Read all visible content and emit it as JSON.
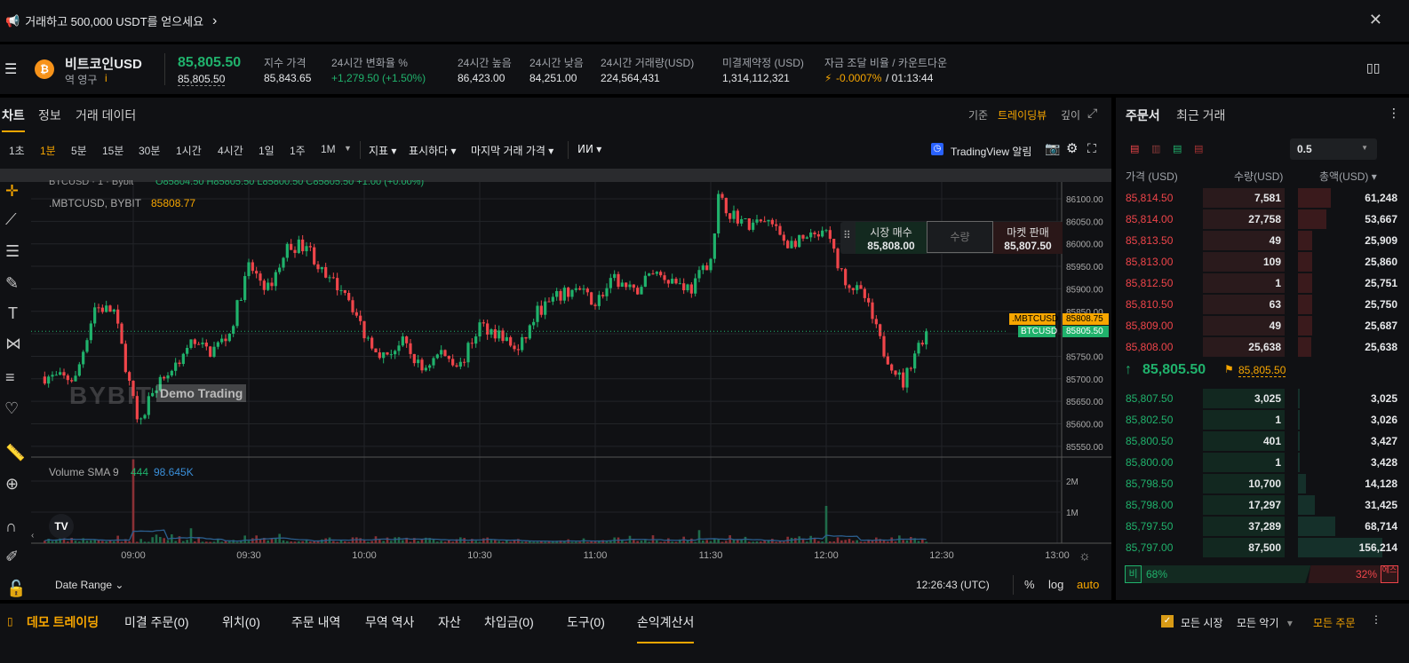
{
  "banner": {
    "text": "거래하고 500,000 USDT를 얻으세요",
    "chevron": "›",
    "close": "✕"
  },
  "ticker": {
    "name": "비트코인USD",
    "sub": "역 영구",
    "info": "i",
    "price": "85,805.50",
    "mark": "85,805.50",
    "stats": [
      {
        "label": "지수 가격",
        "value": "85,843.65"
      },
      {
        "label": "24시간 변화율 %",
        "value": "+1,279.50 (+1.50%)"
      },
      {
        "label": "24시간 높음",
        "value": "86,423.00"
      },
      {
        "label": "24시간 낮음",
        "value": "84,251.00"
      },
      {
        "label": "24시간 거래량(USD)",
        "value": "224,564,431"
      },
      {
        "label": "미결제약정 (USD)",
        "value": "1,314,112,321"
      },
      {
        "label": "자금 조달 비율 / 카운트다운",
        "value": "-0.0007%",
        "countdown": "/ 01:13:44"
      }
    ]
  },
  "chart_tabs": [
    "차트",
    "정보",
    "거래 데이터"
  ],
  "view_modes": {
    "basic": "기준",
    "tradingview": "트레이딩뷰",
    "depth": "깊이"
  },
  "intervals": [
    "1초",
    "1분",
    "5분",
    "15분",
    "30분",
    "1시간",
    "4시간",
    "1일",
    "1주",
    "1M"
  ],
  "active_interval": "1분",
  "toolbar": {
    "indicators": "지표",
    "display": "표시하다",
    "last_price": "마지막 거래 가격",
    "alert": "TradingView 알림"
  },
  "legend": {
    "symbol": "BTCUSD · 1 · Bybit",
    "ohlc": "O85804.50 H85805.50 L85800.50 C85805.50 +1.00 (+0.00%)",
    "index_symbol": ".MBTCUSD, BYBIT",
    "index_value": "85808.77",
    "volume_label": "Volume SMA 9",
    "volume_value": "444",
    "sma_value": "98.645K"
  },
  "watermark": {
    "logo": "BYBIT",
    "text": "Demo Trading"
  },
  "quick_trade": {
    "buy_label": "시장 매수",
    "buy_price": "85,808.00",
    "qty_placeholder": "수량",
    "sell_label": "마켓 판매",
    "sell_price": "85,807.50"
  },
  "price_tags": [
    {
      "name": ".MBTCUSD",
      "value": "85808.75",
      "color": "#f7a600"
    },
    {
      "name": "BTCUSD",
      "value": "85805.50",
      "color": "#20b26c"
    }
  ],
  "chart_footer": {
    "date_range": "Date Range",
    "time": "12:26:43 (UTC)",
    "pct": "%",
    "log": "log",
    "auto": "auto"
  },
  "chart_data": {
    "type": "candlestick",
    "interval": "1m",
    "x_ticks": [
      "09:00",
      "09:30",
      "10:00",
      "10:30",
      "11:00",
      "11:30",
      "12:00",
      "12:30",
      "13:00"
    ],
    "y_ticks": [
      86100,
      86050,
      86000,
      85950,
      85900,
      85850,
      85800,
      85750,
      85700,
      85650,
      85600,
      85550
    ],
    "ylim": [
      85520,
      86135
    ],
    "price_path": [
      [
        "08:36",
        85705
      ],
      [
        "08:45",
        85700
      ],
      [
        "08:50",
        85860
      ],
      [
        "08:55",
        85850
      ],
      [
        "09:00",
        85650
      ],
      [
        "09:02",
        85600
      ],
      [
        "09:05",
        85680
      ],
      [
        "09:10",
        85720
      ],
      [
        "09:15",
        85780
      ],
      [
        "09:20",
        85760
      ],
      [
        "09:25",
        85800
      ],
      [
        "09:30",
        85950
      ],
      [
        "09:35",
        85900
      ],
      [
        "09:40",
        85990
      ],
      [
        "09:45",
        86000
      ],
      [
        "09:50",
        85920
      ],
      [
        "09:55",
        85900
      ],
      [
        "10:00",
        85800
      ],
      [
        "10:05",
        85750
      ],
      [
        "10:10",
        85780
      ],
      [
        "10:15",
        85720
      ],
      [
        "10:20",
        85760
      ],
      [
        "10:25",
        85730
      ],
      [
        "10:30",
        85820
      ],
      [
        "10:35",
        85800
      ],
      [
        "10:40",
        85760
      ],
      [
        "10:45",
        85850
      ],
      [
        "10:50",
        85880
      ],
      [
        "10:55",
        85900
      ],
      [
        "11:00",
        85870
      ],
      [
        "11:05",
        85920
      ],
      [
        "11:10",
        85890
      ],
      [
        "11:15",
        85940
      ],
      [
        "11:20",
        85920
      ],
      [
        "11:25",
        85900
      ],
      [
        "11:30",
        85970
      ],
      [
        "11:32",
        86100
      ],
      [
        "11:35",
        86070
      ],
      [
        "11:40",
        86040
      ],
      [
        "11:45",
        86050
      ],
      [
        "11:50",
        86000
      ],
      [
        "11:55",
        86010
      ],
      [
        "12:00",
        86020
      ],
      [
        "12:05",
        85920
      ],
      [
        "12:10",
        85880
      ],
      [
        "12:15",
        85760
      ],
      [
        "12:20",
        85690
      ],
      [
        "12:23",
        85760
      ],
      [
        "12:26",
        85805.5
      ]
    ],
    "volume_ticks": [
      "2M",
      "1M"
    ],
    "volume_spikes": [
      [
        "09:00",
        2700000
      ],
      [
        "12:00",
        1200000
      ],
      [
        "09:15",
        480000
      ],
      [
        "11:27",
        420000
      ],
      [
        "09:38",
        300000
      ]
    ]
  },
  "orderbook": {
    "tabs": [
      "주문서",
      "최근 거래"
    ],
    "tick": "0.5",
    "headers": [
      "가격 (USD)",
      "수량(USD)",
      "총액(USD)"
    ],
    "asks": [
      [
        "85,814.50",
        "7,581",
        "61,248",
        0.39
      ],
      [
        "85,814.00",
        "27,758",
        "53,667",
        0.34
      ],
      [
        "85,813.50",
        "49",
        "25,909",
        0.17
      ],
      [
        "85,813.00",
        "109",
        "25,860",
        0.17
      ],
      [
        "85,812.50",
        "1",
        "25,751",
        0.17
      ],
      [
        "85,810.50",
        "63",
        "25,750",
        0.17
      ],
      [
        "85,809.00",
        "49",
        "25,687",
        0.17
      ],
      [
        "85,808.00",
        "25,638",
        "25,638",
        0.16
      ]
    ],
    "last": "85,805.50",
    "mark": "85,805.50",
    "bids": [
      [
        "85,807.50",
        "3,025",
        "3,025",
        0.02
      ],
      [
        "85,802.50",
        "1",
        "3,026",
        0.02
      ],
      [
        "85,800.50",
        "401",
        "3,427",
        0.02
      ],
      [
        "85,800.00",
        "1",
        "3,428",
        0.02
      ],
      [
        "85,798.50",
        "10,700",
        "14,128",
        0.09
      ],
      [
        "85,798.00",
        "17,297",
        "31,425",
        0.2
      ],
      [
        "85,797.50",
        "37,289",
        "68,714",
        0.44
      ],
      [
        "85,797.00",
        "87,500",
        "156,214",
        1.0
      ]
    ],
    "buy_label": "비",
    "buy_pct": "68%",
    "sell_pct": "32%",
    "sell_label": "에스",
    "buy_ratio": 68
  },
  "bottom": {
    "tabs": [
      "데모 트레이딩",
      "미결 주문(0)",
      "위치(0)",
      "주문 내역",
      "무역 역사",
      "자산",
      "차입금(0)",
      "도구(0)",
      "손익계산서"
    ],
    "all_markets": "모든 시장",
    "all_instruments": "모든 악기",
    "all_orders": "모든 주문"
  },
  "colors": {
    "accent": "#f7a600",
    "up": "#20b26c",
    "down": "#ef454a"
  }
}
